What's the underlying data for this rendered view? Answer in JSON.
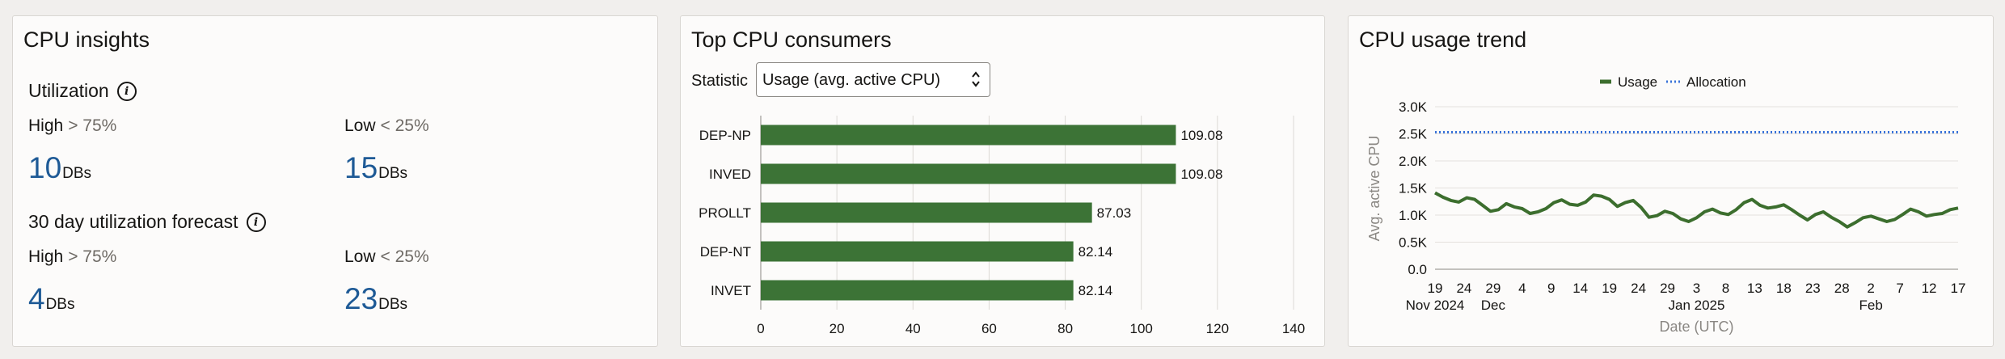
{
  "insights": {
    "title": "CPU insights",
    "utilization": {
      "title": "Utilization",
      "high_label": "High",
      "high_threshold": "> 75%",
      "low_label": "Low",
      "low_threshold": "< 25%",
      "high_count": "10",
      "low_count": "15",
      "unit": "DBs"
    },
    "forecast": {
      "title": "30 day utilization forecast",
      "high_label": "High",
      "high_threshold": "> 75%",
      "low_label": "Low",
      "low_threshold": "< 25%",
      "high_count": "4",
      "low_count": "23",
      "unit": "DBs"
    }
  },
  "consumers": {
    "title": "Top CPU consumers",
    "statistic_label": "Statistic",
    "statistic_value": "Usage (avg. active CPU)"
  },
  "trend": {
    "title": "CPU usage trend"
  },
  "colors": {
    "bar": "#3c7336",
    "usage_line": "#3c6e2e",
    "allocation_line": "#3a73d9",
    "metric_number": "#1e5a96"
  },
  "chart_data": [
    {
      "type": "bar",
      "orientation": "horizontal",
      "categories": [
        "DEP-NP",
        "INVED",
        "PROLLT",
        "DEP-NT",
        "INVET"
      ],
      "values": [
        109.08,
        109.08,
        87.03,
        82.14,
        82.14
      ],
      "value_labels": [
        "109.08",
        "109.08",
        "87.03",
        "82.14",
        "82.14"
      ],
      "xlim": [
        0,
        140
      ],
      "x_ticks": [
        "0",
        "20",
        "40",
        "60",
        "80",
        "100",
        "120",
        "140"
      ],
      "grid": true
    },
    {
      "type": "line",
      "ylabel": "Avg. active CPU",
      "xlabel": "Date (UTC)",
      "ylim": [
        0,
        3000
      ],
      "y_ticks": [
        "0.0",
        "0.5K",
        "1.0K",
        "1.5K",
        "2.0K",
        "2.5K",
        "3.0K"
      ],
      "x_ticks": [
        "19",
        "24",
        "29",
        "4",
        "9",
        "14",
        "19",
        "24",
        "29",
        "3",
        "8",
        "13",
        "18",
        "23",
        "28",
        "2",
        "7",
        "12",
        "17"
      ],
      "x_month_labels": [
        {
          "text": "Nov 2024",
          "tick": 0
        },
        {
          "text": "Dec",
          "tick": 2
        },
        {
          "text": "Jan 2025",
          "tick": 9
        },
        {
          "text": "Feb",
          "tick": 15
        }
      ],
      "legend": {
        "position": "top",
        "items": [
          "Usage",
          "Allocation"
        ]
      },
      "series": [
        {
          "name": "Usage",
          "style": "solid",
          "values": [
            1410,
            1330,
            1270,
            1240,
            1320,
            1290,
            1180,
            1070,
            1100,
            1210,
            1150,
            1120,
            1030,
            1060,
            1120,
            1230,
            1280,
            1200,
            1180,
            1240,
            1370,
            1350,
            1290,
            1160,
            1230,
            1270,
            1140,
            960,
            990,
            1070,
            1030,
            930,
            880,
            950,
            1060,
            1110,
            1040,
            1010,
            1100,
            1230,
            1290,
            1180,
            1130,
            1150,
            1190,
            1100,
            1000,
            910,
            1010,
            1060,
            960,
            880,
            780,
            860,
            950,
            980,
            930,
            880,
            920,
            1010,
            1110,
            1060,
            980,
            1010,
            1030,
            1100,
            1130
          ]
        },
        {
          "name": "Allocation",
          "style": "dotted",
          "values": [
            2530,
            2530
          ]
        }
      ]
    }
  ]
}
